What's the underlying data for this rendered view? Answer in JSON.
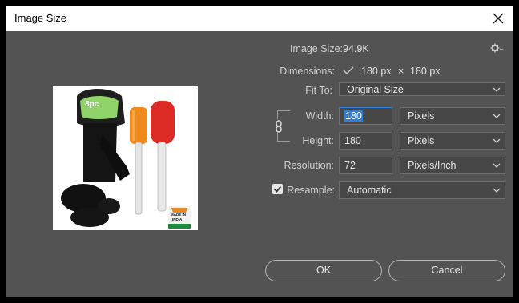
{
  "window": {
    "title": "Image Size"
  },
  "info": {
    "image_size_label": "Image Size:",
    "image_size_value": "94.9K",
    "dimensions_label": "Dimensions:",
    "dim_width": "180 px",
    "dim_times": "×",
    "dim_height": "180 px"
  },
  "fit_to": {
    "label": "Fit To:",
    "value": "Original Size"
  },
  "width": {
    "label": "Width:",
    "value": "180",
    "unit": "Pixels"
  },
  "height": {
    "label": "Height:",
    "value": "180",
    "unit": "Pixels"
  },
  "resolution": {
    "label": "Resolution:",
    "value": "72",
    "unit": "Pixels/Inch"
  },
  "resample": {
    "label": "Resample:",
    "checked": true,
    "value": "Automatic"
  },
  "preview": {
    "badge_text": "8pc",
    "made_in_line1": "MADE IN",
    "made_in_line2": "INDIA"
  },
  "buttons": {
    "ok": "OK",
    "cancel": "Cancel"
  },
  "icons": [
    "close-icon",
    "gear-icon",
    "checkmark-icon",
    "chain-link-icon",
    "chevron-down-icon"
  ],
  "colors": {
    "panel": "#535353",
    "accent": "#2f7fd6",
    "titlebar": "#ffffff"
  }
}
